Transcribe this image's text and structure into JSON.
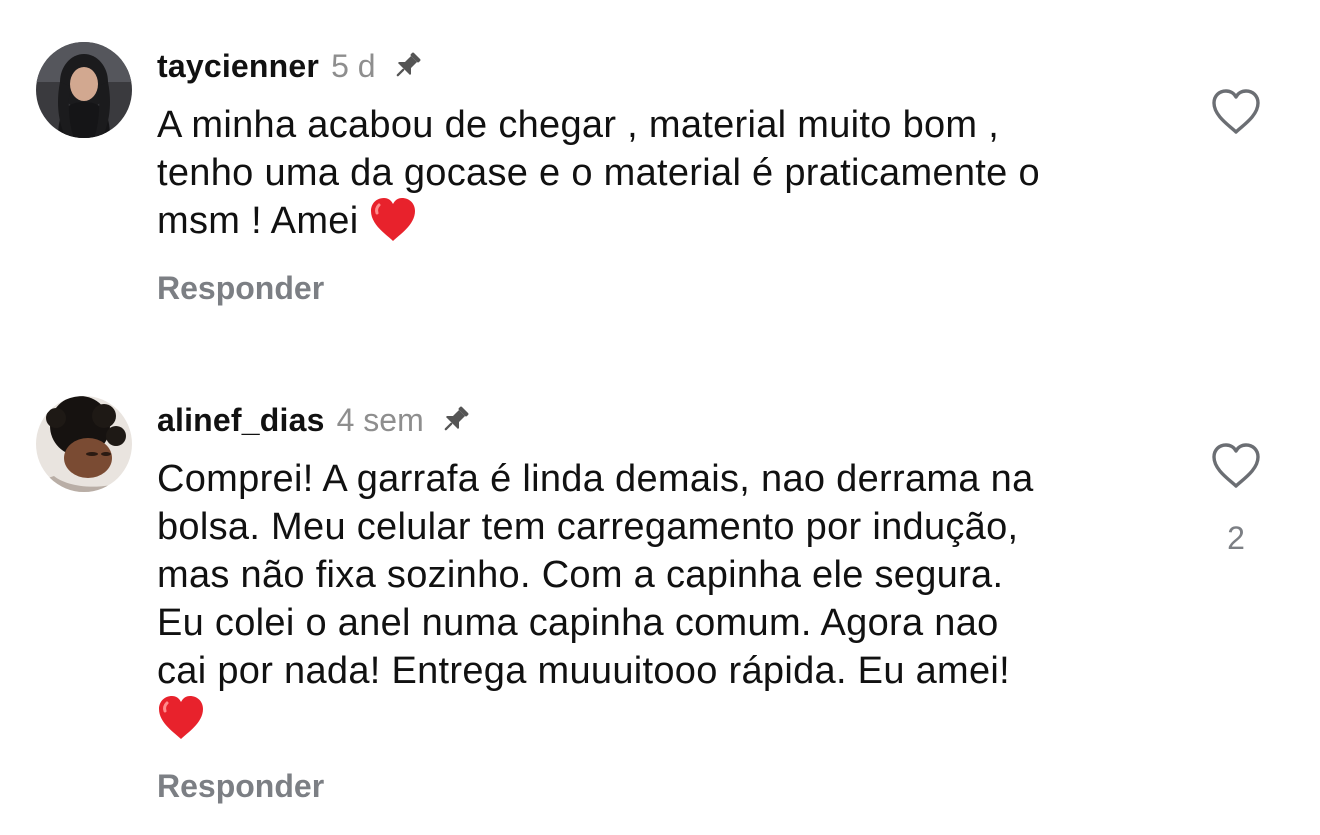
{
  "comments": [
    {
      "username": "taycienner",
      "time": "5 d",
      "text_lines": [
        "A minha acabou de chegar , material muito bom ,",
        "tenho uma da gocase e o material é praticamente o",
        "msm ! Amei"
      ],
      "reply_label": "Responder",
      "like_count": "",
      "avatar_icon": "profile-photo",
      "pin_icon": "pin-icon",
      "like_icon": "heart-outline-icon"
    },
    {
      "username": "alinef_dias",
      "time": "4 sem",
      "text_lines": [
        "Comprei! A garrafa é linda demais, nao derrama na",
        "bolsa. Meu celular tem carregamento por indução,",
        "mas não fixa sozinho. Com a capinha ele segura.",
        "Eu colei o anel numa capinha comum. Agora nao",
        "cai por nada! Entrega muuuitooo rápida. Eu amei!"
      ],
      "reply_label": "Responder",
      "like_count": "2",
      "avatar_icon": "profile-photo",
      "pin_icon": "pin-icon",
      "like_icon": "heart-outline-icon"
    }
  ],
  "colors": {
    "text": "#111111",
    "muted": "#8e8e8e",
    "reply": "#7c7f84",
    "heart_emoji": "#e8222c"
  }
}
